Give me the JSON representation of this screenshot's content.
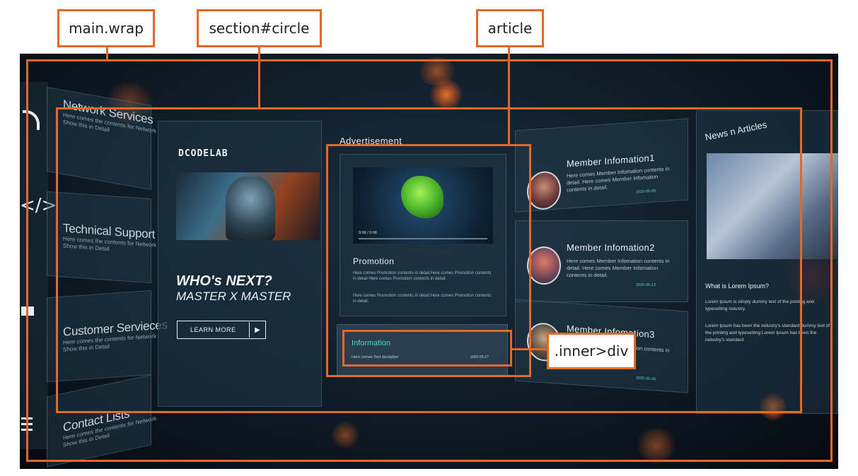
{
  "annotations": {
    "wrap": "main.wrap",
    "circle": "section#circle",
    "article": "article",
    "inner": ".inner>div"
  },
  "sidebar": {
    "items": [
      {
        "title": "Network Services",
        "desc1": "Here comes the contents for Network",
        "desc2": "Show this in Detail"
      },
      {
        "title": "Technical Support",
        "desc1": "Here comes the contents for Network",
        "desc2": "Show this in Detail"
      },
      {
        "title": "Customer Servieces",
        "desc1": "Here comes the contents for Network",
        "desc2": "Show this in Detail"
      },
      {
        "title": "Contact Lists",
        "desc1": "Here comes the contents for Network",
        "desc2": "Show this in Detail"
      }
    ],
    "icons": [
      "wifi-icon",
      "code-icon",
      "mail-icon",
      "list-icon"
    ]
  },
  "promo_card": {
    "logo": "DCODELAB",
    "headline": "WHO's NEXT?",
    "subheadline": "MASTER X MASTER",
    "button": "LEARN MORE"
  },
  "advertisement": {
    "heading": "Advertisement",
    "video_time": "0:06 / 0:06",
    "promotion_title": "Promotion",
    "promotion_p1": "Here comes Promotion contents in detail.Here comes Promotion contents in detail Here comes Promotion contents in detail.",
    "promotion_p2": "Here comes Promotion contents in detail.Here comes Promotion contents in detail.",
    "info_title": "Information",
    "info_text": "Here comes Text dscription",
    "info_date": "2020-05-27"
  },
  "members": [
    {
      "name": "Member Infomation1",
      "text": "Here comes Member Infomation contents in detail. Here comes Member Infomation contents in detail.",
      "date": "2020-05-05"
    },
    {
      "name": "Member Infomation2",
      "text": "Here comes Member Infomation contents in detail. Here comes Member Infomation contents in detail.",
      "date": "2020-05-12"
    },
    {
      "name": "Member Infomation3",
      "text": "Here comes Member Infomation contents in detail.",
      "date": "2020-05-20"
    }
  ],
  "news": {
    "heading": "News n Articles",
    "subtitle": "What is Lorem Ipsum?",
    "p1": "Lorem Ipsum is simply dummy text of the printing and typesetting industry.",
    "p2": "Lorem Ipsum has been the industry's standard dummy text of the printing and typesetting Lorem Ipsum has been the industry's standard."
  },
  "colors": {
    "accent": "#e2692a",
    "teal": "#4dd6c8",
    "bg": "#0e1b26"
  }
}
